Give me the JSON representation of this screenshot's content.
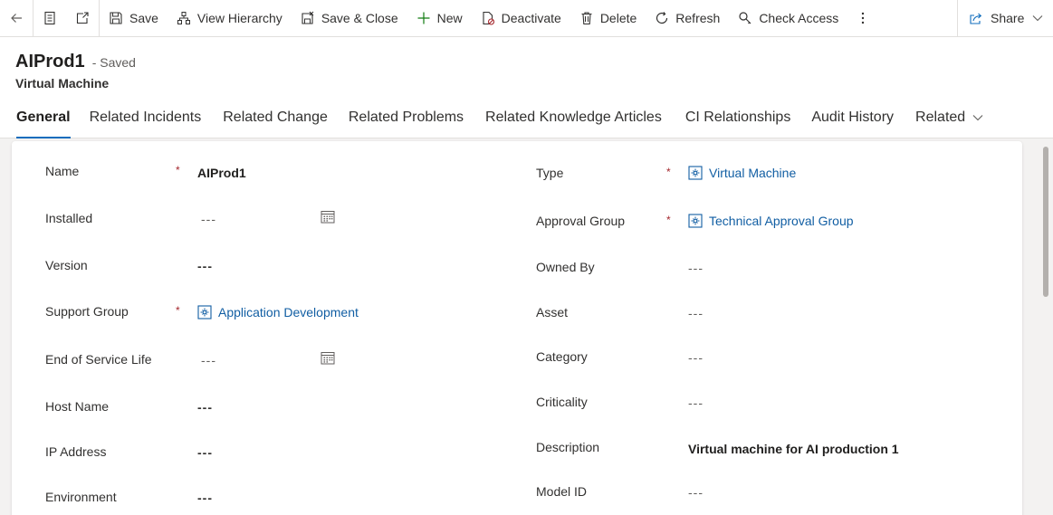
{
  "commands": {
    "save": "Save",
    "view_hierarchy": "View Hierarchy",
    "save_close": "Save & Close",
    "new": "New",
    "deactivate": "Deactivate",
    "delete": "Delete",
    "refresh": "Refresh",
    "check_access": "Check Access",
    "share": "Share"
  },
  "header": {
    "title": "AIProd1",
    "saved_status": "- Saved",
    "entity": "Virtual Machine"
  },
  "tabs": [
    "General",
    "Related Incidents",
    "Related Change",
    "Related Problems",
    "Related Knowledge Articles",
    "CI Relationships",
    "Audit History",
    "Related"
  ],
  "left_fields": {
    "name": {
      "label": "Name",
      "value": "AIProd1",
      "required": "*"
    },
    "installed": {
      "label": "Installed",
      "value": "---"
    },
    "version": {
      "label": "Version",
      "value": "---"
    },
    "support_group": {
      "label": "Support Group",
      "value": "Application Development",
      "required": "*"
    },
    "end_of_service_life": {
      "label": "End of Service Life",
      "value": "---"
    },
    "host_name": {
      "label": "Host Name",
      "value": "---"
    },
    "ip_address": {
      "label": "IP Address",
      "value": "---"
    },
    "environment": {
      "label": "Environment",
      "value": "---"
    }
  },
  "right_fields": {
    "type": {
      "label": "Type",
      "value": "Virtual Machine",
      "required": "*"
    },
    "approval_group": {
      "label": "Approval Group",
      "value": "Technical Approval Group",
      "required": "*"
    },
    "owned_by": {
      "label": "Owned By",
      "value": "---"
    },
    "asset": {
      "label": "Asset",
      "value": "---"
    },
    "category": {
      "label": "Category",
      "value": "---"
    },
    "criticality": {
      "label": "Criticality",
      "value": "---"
    },
    "description": {
      "label": "Description",
      "value": "Virtual machine for AI production 1"
    },
    "model_id": {
      "label": "Model ID",
      "value": "---"
    }
  },
  "colors": {
    "accent": "#0f6cbd",
    "link": "#115ea3",
    "required": "#a4262c"
  },
  "icons": [
    "back-arrow-icon",
    "form-icon",
    "open-new-window-icon",
    "save-icon",
    "hierarchy-icon",
    "save-close-icon",
    "plus-icon",
    "deactivate-icon",
    "trash-icon",
    "refresh-icon",
    "check-access-icon",
    "more-icon",
    "share-icon",
    "chevron-down-icon",
    "calendar-icon",
    "lookup-entity-icon"
  ]
}
